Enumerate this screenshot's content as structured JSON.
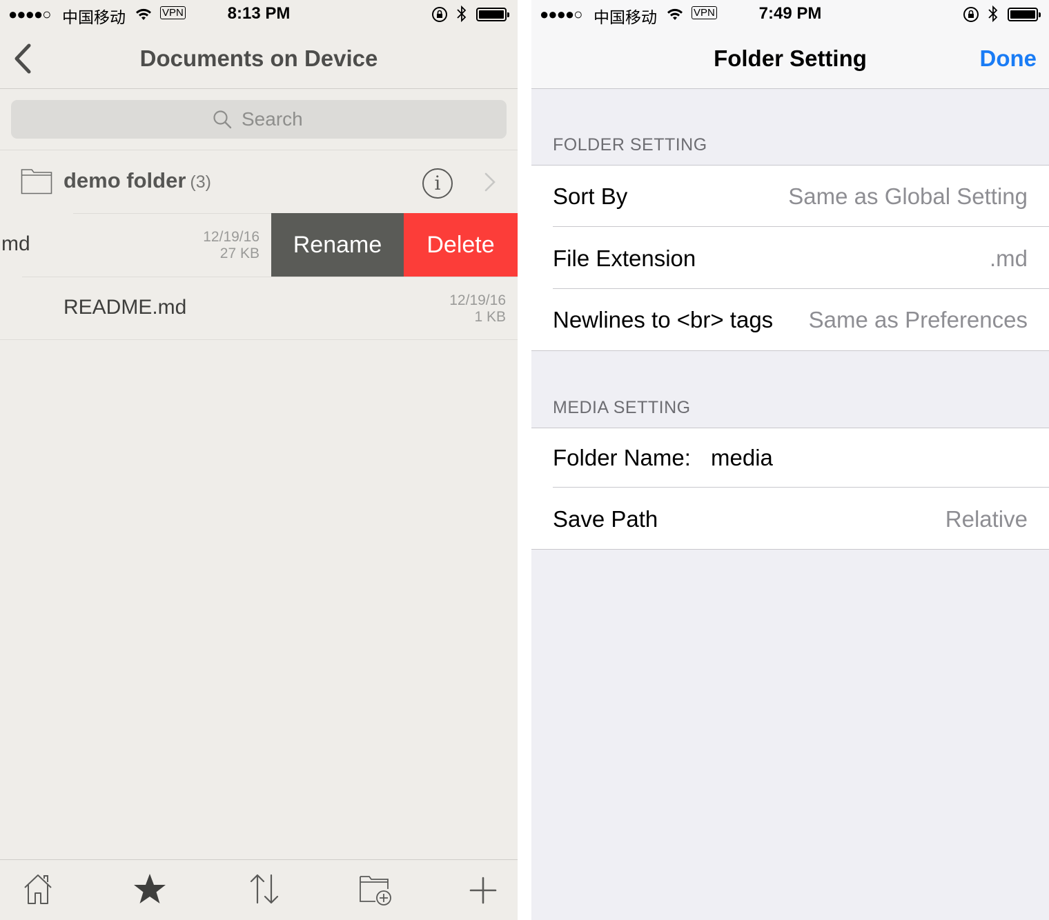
{
  "left": {
    "status": {
      "signal": "●●●●○",
      "carrier": "中国移动",
      "vpn": "VPN",
      "time": "8:13 PM"
    },
    "nav": {
      "title": "Documents on Device"
    },
    "search": {
      "placeholder": "Search"
    },
    "folder": {
      "name": "demo folder",
      "count": "(3)"
    },
    "files": [
      {
        "name": "md",
        "date": "12/19/16",
        "size": "27 KB"
      },
      {
        "name": "README.md",
        "date": "12/19/16",
        "size": "1 KB"
      }
    ],
    "swipe_actions": {
      "rename": "Rename",
      "delete": "Delete"
    },
    "toolbar": [
      "home-icon",
      "star-icon",
      "sort-icon",
      "new-folder-icon",
      "add-icon"
    ]
  },
  "right": {
    "status": {
      "signal": "●●●●○",
      "carrier": "中国移动",
      "vpn": "VPN",
      "time": "7:49 PM"
    },
    "nav": {
      "title": "Folder Setting",
      "done": "Done"
    },
    "sections": {
      "folder": {
        "header": "FOLDER SETTING",
        "rows": [
          {
            "label": "Sort By",
            "value": "Same as Global Setting"
          },
          {
            "label": "File Extension",
            "value": ".md"
          },
          {
            "label": "Newlines to <br> tags",
            "value": "Same as Preferences"
          }
        ]
      },
      "media": {
        "header": "MEDIA SETTING",
        "folder_name_label": "Folder Name:",
        "folder_name_value": "media",
        "save_path_label": "Save Path",
        "save_path_value": "Relative"
      }
    }
  },
  "colors": {
    "accent": "#1a7cf5",
    "delete": "#fc3d39",
    "rename": "#5a5b57",
    "left_bg": "#efede9",
    "right_bg": "#efeff4"
  }
}
